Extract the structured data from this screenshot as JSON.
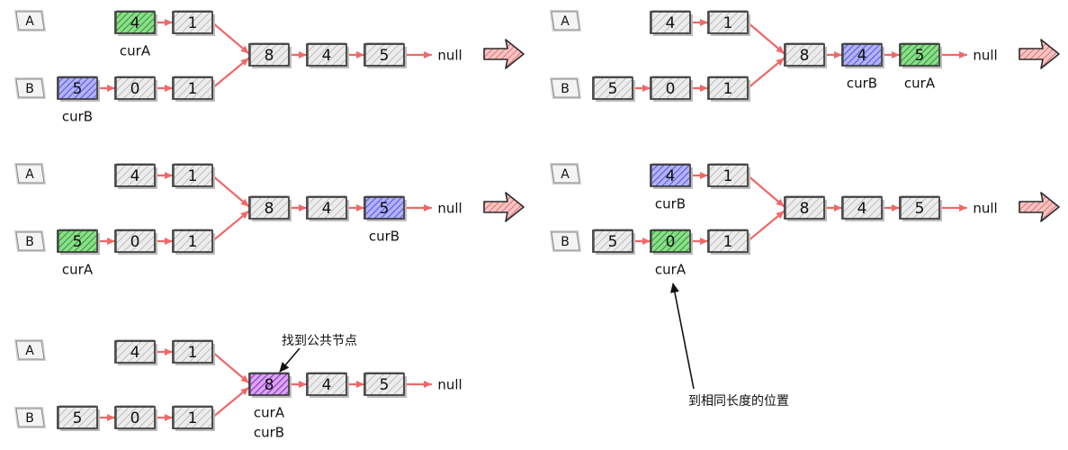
{
  "colors": {
    "link": "#f06868",
    "node_fill": "#e2e2e2",
    "node_stroke": "#2b2b2b",
    "pointer_a": "#3cb83c",
    "pointer_b": "#6f6ff0",
    "pointer_both": "#a93ad6",
    "tag_fill": "#f4f4f4",
    "arrow_fill": "#f2a6a6",
    "arrow_stroke": "#d84040"
  },
  "panels": [
    {
      "id": "step1",
      "list_a_label": "A",
      "list_b_label": "B",
      "list_a": [
        "4",
        "1"
      ],
      "list_b": [
        "5",
        "0",
        "1"
      ],
      "shared": [
        "8",
        "4",
        "5"
      ],
      "tail": "null",
      "highlights": [
        {
          "node": "a0",
          "color": "pointer_a",
          "label": "curA"
        },
        {
          "node": "b0",
          "color": "pointer_b",
          "label": "curB"
        }
      ],
      "next_arrow": true
    },
    {
      "id": "step2",
      "list_a_label": "A",
      "list_b_label": "B",
      "list_a": [
        "4",
        "1"
      ],
      "list_b": [
        "5",
        "0",
        "1"
      ],
      "shared": [
        "8",
        "4",
        "5"
      ],
      "tail": "null",
      "highlights": [
        {
          "node": "s1",
          "color": "pointer_b",
          "label": "curB"
        },
        {
          "node": "s2",
          "color": "pointer_a",
          "label": "curA"
        }
      ],
      "next_arrow": true
    },
    {
      "id": "step3",
      "list_a_label": "A",
      "list_b_label": "B",
      "list_a": [
        "4",
        "1"
      ],
      "list_b": [
        "5",
        "0",
        "1"
      ],
      "shared": [
        "8",
        "4",
        "5"
      ],
      "tail": "null",
      "highlights": [
        {
          "node": "b0",
          "color": "pointer_a",
          "label": "curA"
        },
        {
          "node": "s2",
          "color": "pointer_b",
          "label": "curB"
        }
      ],
      "next_arrow": true
    },
    {
      "id": "step4",
      "list_a_label": "A",
      "list_b_label": "B",
      "list_a": [
        "4",
        "1"
      ],
      "list_b": [
        "5",
        "0",
        "1"
      ],
      "shared": [
        "8",
        "4",
        "5"
      ],
      "tail": "null",
      "highlights": [
        {
          "node": "a0",
          "color": "pointer_b",
          "label": "curB"
        },
        {
          "node": "b1",
          "color": "pointer_a",
          "label": "curA"
        }
      ],
      "note": {
        "text": "到相同长度的位置",
        "target": "b1"
      },
      "next_arrow": true
    },
    {
      "id": "step5",
      "list_a_label": "A",
      "list_b_label": "B",
      "list_a": [
        "4",
        "1"
      ],
      "list_b": [
        "5",
        "0",
        "1"
      ],
      "shared": [
        "8",
        "4",
        "5"
      ],
      "tail": "null",
      "highlights": [
        {
          "node": "s0",
          "color": "pointer_both",
          "label": "curA",
          "label2": "curB"
        }
      ],
      "note": {
        "text": "找到公共节点",
        "target": "s0"
      },
      "next_arrow": false
    }
  ]
}
